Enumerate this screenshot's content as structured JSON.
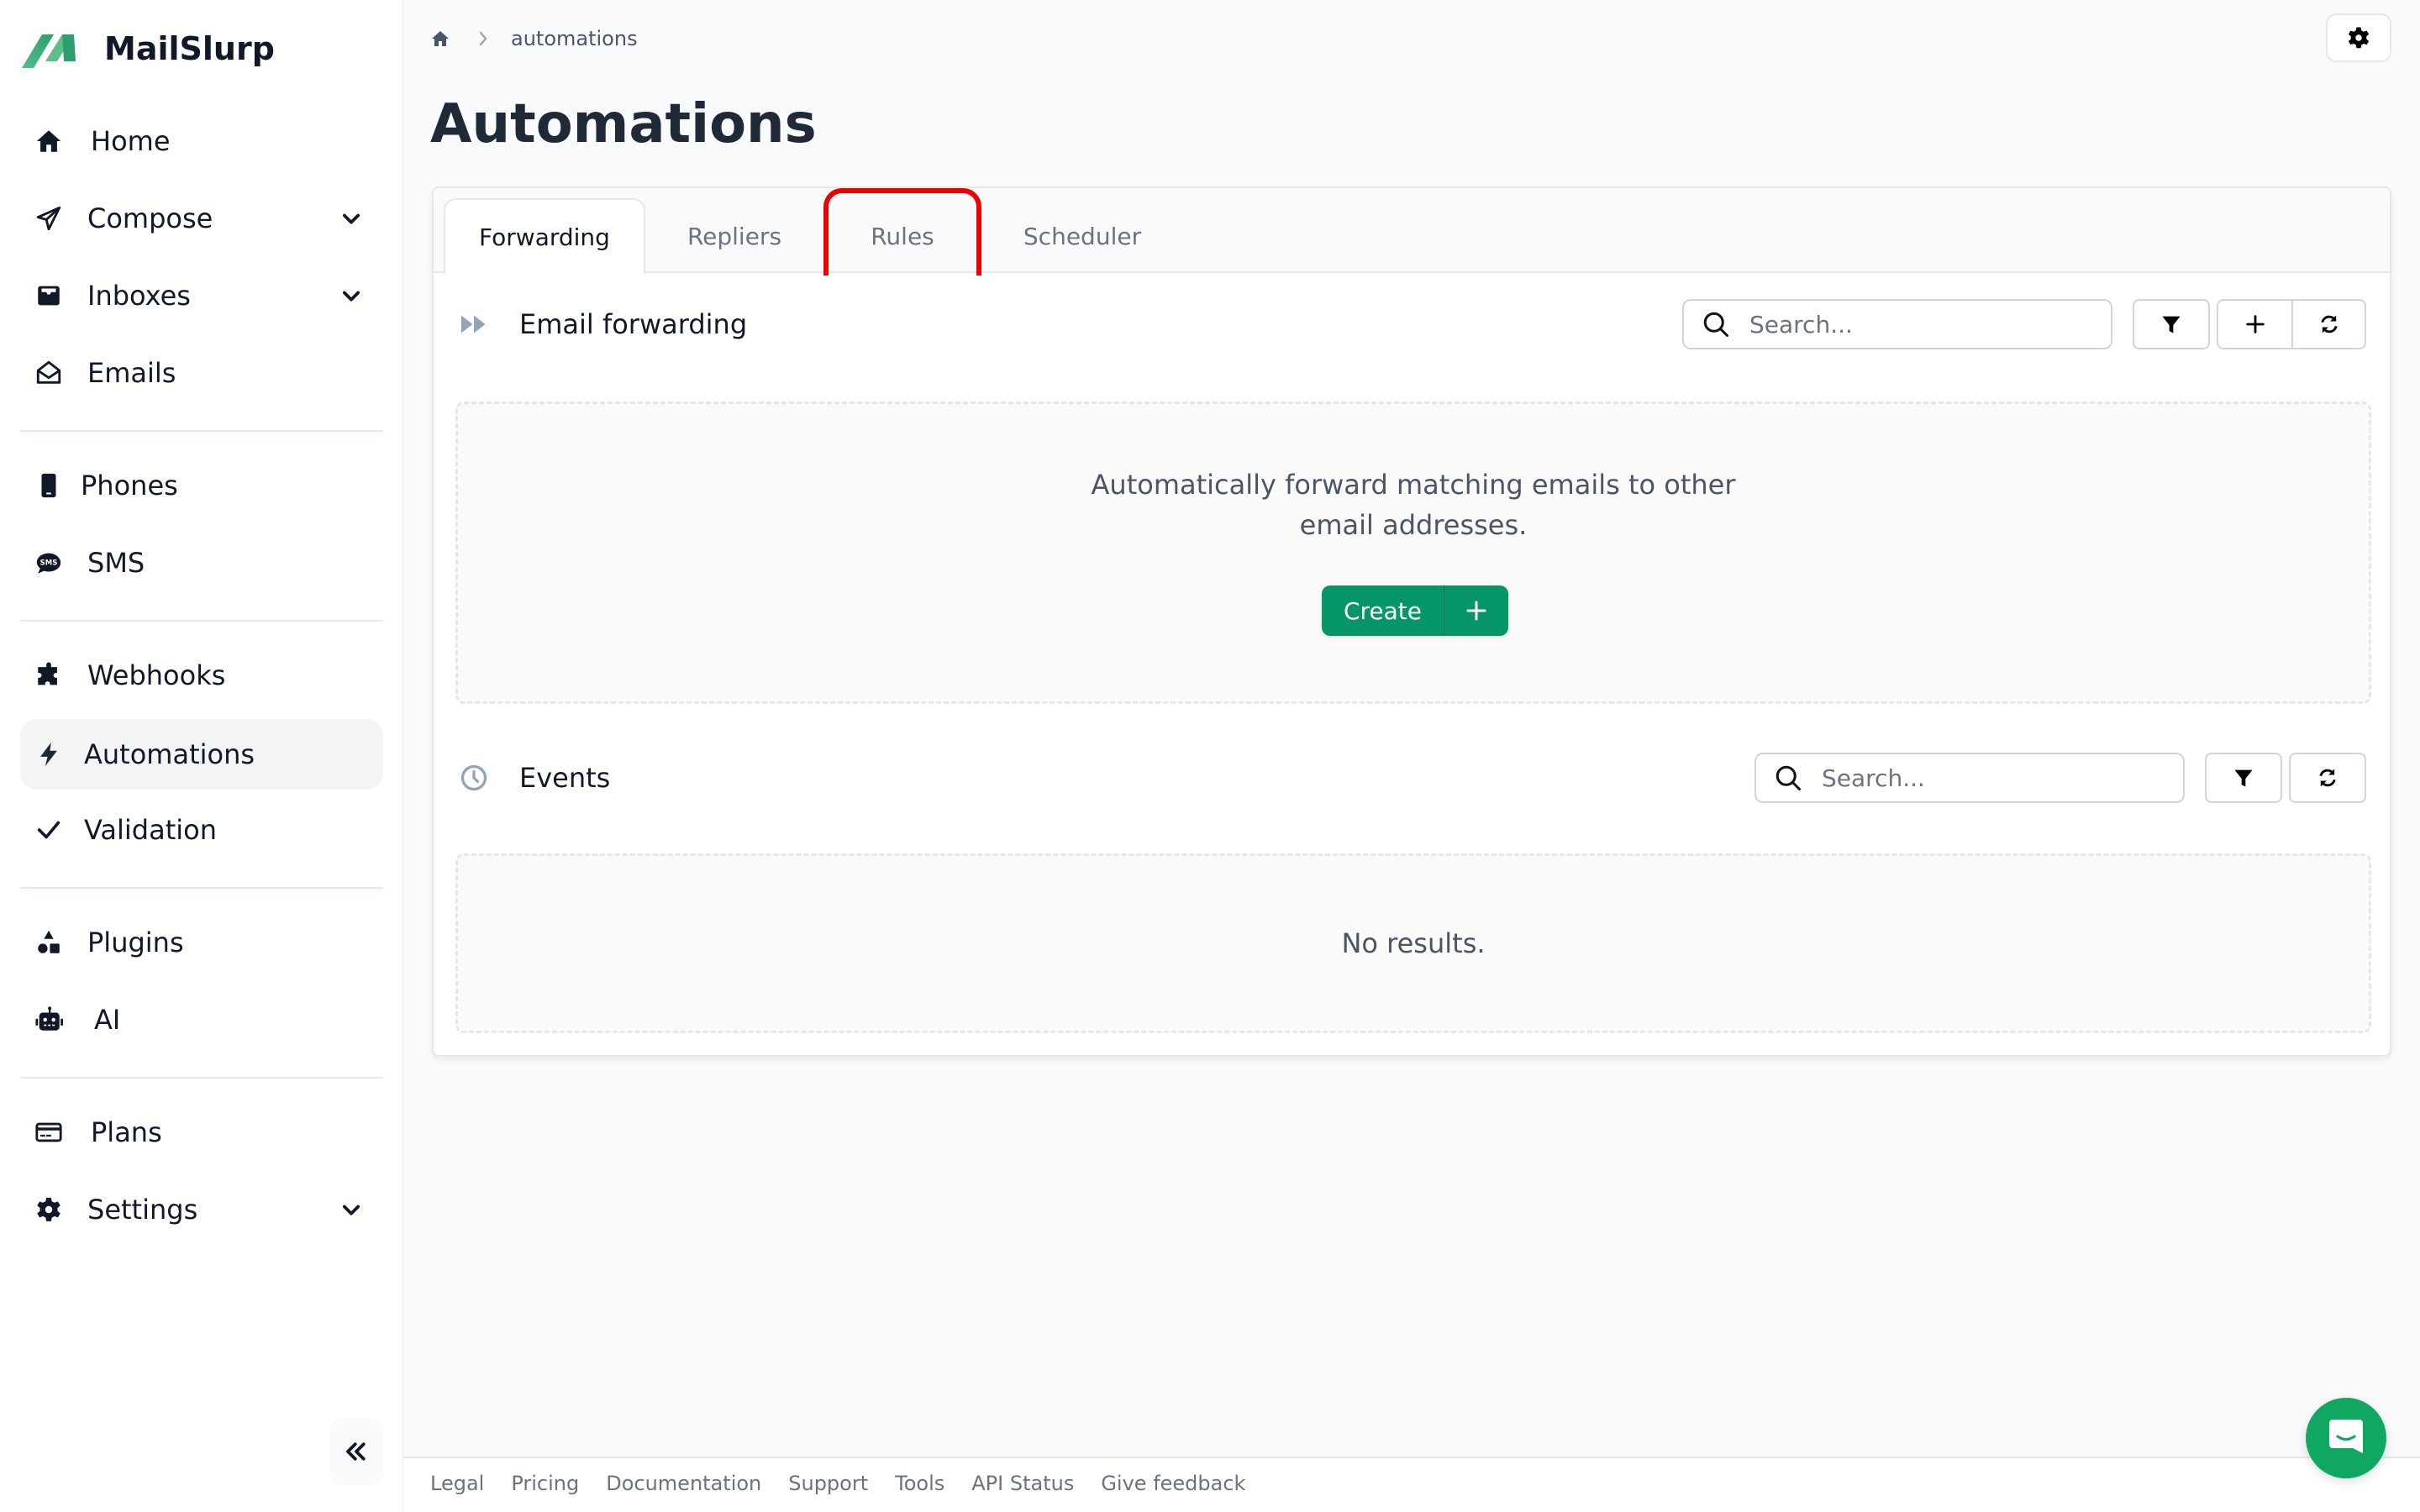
{
  "app": {
    "name": "MailSlurp",
    "brand_color": "#079669"
  },
  "sidebar": {
    "items": [
      {
        "label": "Home",
        "icon": "home-icon"
      },
      {
        "label": "Compose",
        "icon": "paper-plane-icon",
        "expandable": true
      },
      {
        "label": "Inboxes",
        "icon": "inbox-icon",
        "expandable": true
      },
      {
        "label": "Emails",
        "icon": "envelope-open-icon"
      },
      {
        "label": "Phones",
        "icon": "phone-icon"
      },
      {
        "label": "SMS",
        "icon": "sms-icon"
      },
      {
        "label": "Webhooks",
        "icon": "puzzle-icon"
      },
      {
        "label": "Automations",
        "icon": "bolt-icon",
        "active": true
      },
      {
        "label": "Validation",
        "icon": "check-icon"
      },
      {
        "label": "Plugins",
        "icon": "shapes-icon"
      },
      {
        "label": "AI",
        "icon": "robot-icon"
      },
      {
        "label": "Plans",
        "icon": "credit-card-icon"
      },
      {
        "label": "Settings",
        "icon": "gear-icon",
        "expandable": true
      }
    ],
    "collapse_icon": "double-chevron-left-icon"
  },
  "header": {
    "breadcrumb": [
      "automations"
    ],
    "title": "Automations",
    "settings_icon": "gear-icon"
  },
  "tabs": [
    {
      "label": "Forwarding",
      "active": true
    },
    {
      "label": "Repliers",
      "active": false
    },
    {
      "label": "Rules",
      "active": false,
      "highlighted": true
    },
    {
      "label": "Scheduler",
      "active": false
    }
  ],
  "forwarding": {
    "title": "Email forwarding",
    "search_placeholder": "Search...",
    "search_value": "",
    "empty_text": "Automatically forward matching emails to other email addresses.",
    "create_label": "Create"
  },
  "events": {
    "title": "Events",
    "search_placeholder": "Search...",
    "search_value": "",
    "empty_text": "No results."
  },
  "footer": {
    "links": [
      "Legal",
      "Pricing",
      "Documentation",
      "Support",
      "Tools",
      "API Status",
      "Give feedback"
    ]
  }
}
